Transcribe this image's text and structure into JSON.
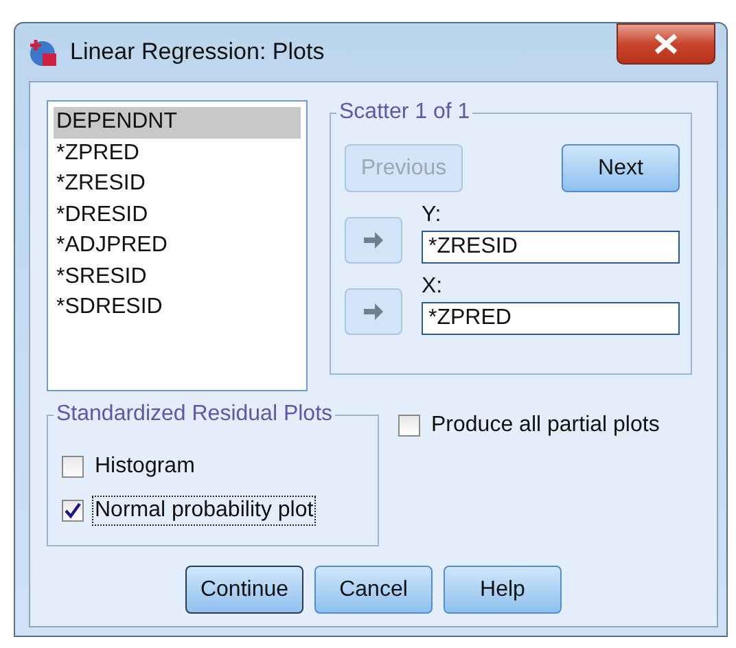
{
  "window": {
    "title": "Linear Regression: Plots"
  },
  "variables": [
    {
      "label": "DEPENDNT",
      "selected": true
    },
    {
      "label": "*ZPRED",
      "selected": false
    },
    {
      "label": "*ZRESID",
      "selected": false
    },
    {
      "label": "*DRESID",
      "selected": false
    },
    {
      "label": "*ADJPRED",
      "selected": false
    },
    {
      "label": "*SRESID",
      "selected": false
    },
    {
      "label": "*SDRESID",
      "selected": false
    }
  ],
  "scatter": {
    "title": "Scatter 1 of 1",
    "previous": {
      "label": "Previous",
      "disabled": true
    },
    "next": {
      "label": "Next",
      "disabled": false
    },
    "axes": [
      {
        "label": "Y:",
        "value": "*ZRESID"
      },
      {
        "label": "X:",
        "value": "*ZPRED"
      }
    ]
  },
  "residual_plots": {
    "title": "Standardized Residual Plots",
    "options": [
      {
        "label": "Histogram",
        "checked": false,
        "focused": false
      },
      {
        "label": "Normal probability plot",
        "checked": true,
        "focused": true
      }
    ]
  },
  "partial_plots": {
    "label": "Produce all partial plots",
    "checked": false
  },
  "buttons": [
    {
      "label": "Continue",
      "default": true
    },
    {
      "label": "Cancel",
      "default": false
    },
    {
      "label": "Help",
      "default": false
    }
  ]
}
